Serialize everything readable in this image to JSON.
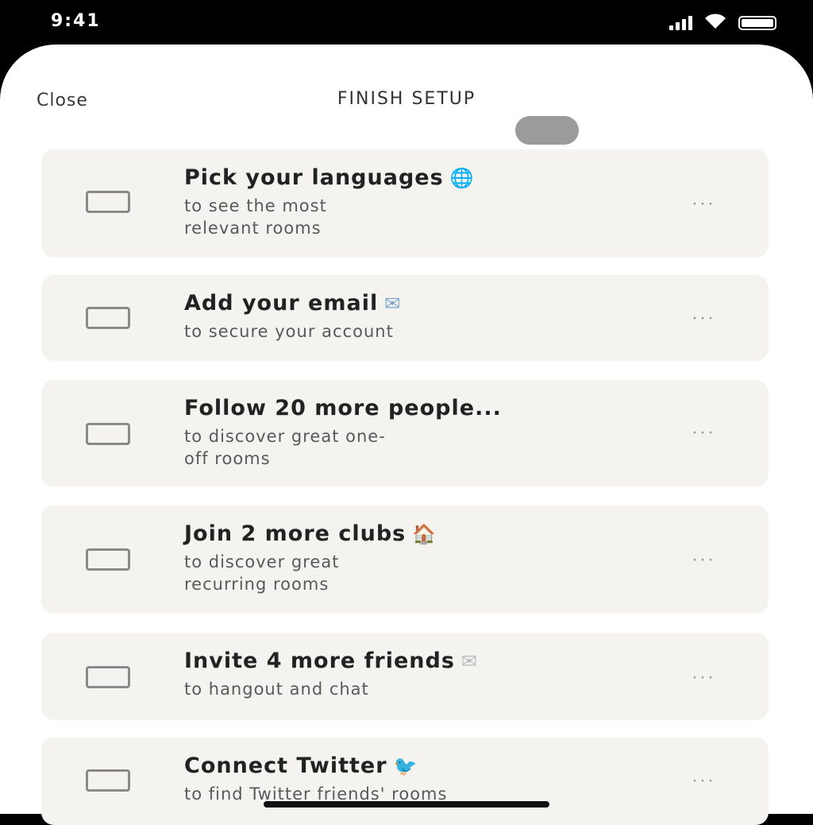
{
  "status_bar": {
    "time": "9:41"
  },
  "sheet": {
    "close_label": "Close",
    "title": "FINISH SETUP"
  },
  "tasks": [
    {
      "title": "Pick your languages",
      "emoji": "🌐",
      "subtitle": "to see the most\nrelevant rooms",
      "more": "···"
    },
    {
      "title": "Add your email",
      "emoji": "✉",
      "subtitle": "to secure your account",
      "more": "···"
    },
    {
      "title": "Follow 20 more people...",
      "emoji": "",
      "subtitle": "to discover great one-\noff rooms",
      "more": "···"
    },
    {
      "title": "Join 2 more clubs",
      "emoji": "🏠",
      "subtitle": "to discover great\nrecurring rooms",
      "more": "···"
    },
    {
      "title": "Invite 4 more friends",
      "emoji": "✉",
      "subtitle": "to hangout and chat",
      "more": "···"
    },
    {
      "title": "Connect Twitter",
      "emoji": "🐦",
      "subtitle": "to find Twitter friends' rooms",
      "more": "···"
    }
  ],
  "colors": {
    "card_bg": "#f4f3ef",
    "sheet_bg": "#ffffff",
    "status_bg": "#000000"
  }
}
